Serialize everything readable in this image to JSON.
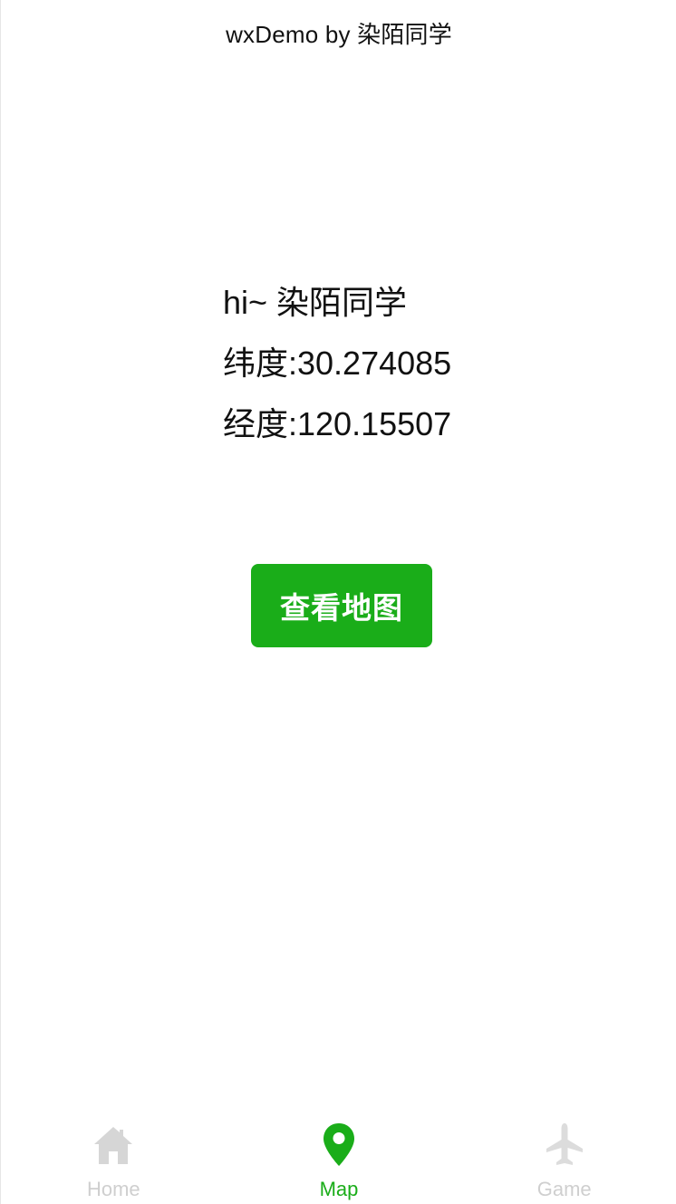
{
  "nav": {
    "title": "wxDemo by 染陌同学"
  },
  "info": {
    "greeting": "hi~ 染陌同学",
    "latitude": "纬度:30.274085",
    "longitude": "经度:120.15507"
  },
  "action": {
    "view_map_label": "查看地图"
  },
  "tabbar": {
    "items": [
      {
        "label": "Home",
        "icon": "home-icon",
        "active": false
      },
      {
        "label": "Map",
        "icon": "map-pin-icon",
        "active": true
      },
      {
        "label": "Game",
        "icon": "airplane-icon",
        "active": false
      }
    ]
  },
  "colors": {
    "accent": "#1aad19",
    "inactive": "#cfcfcf",
    "text": "#111111"
  }
}
